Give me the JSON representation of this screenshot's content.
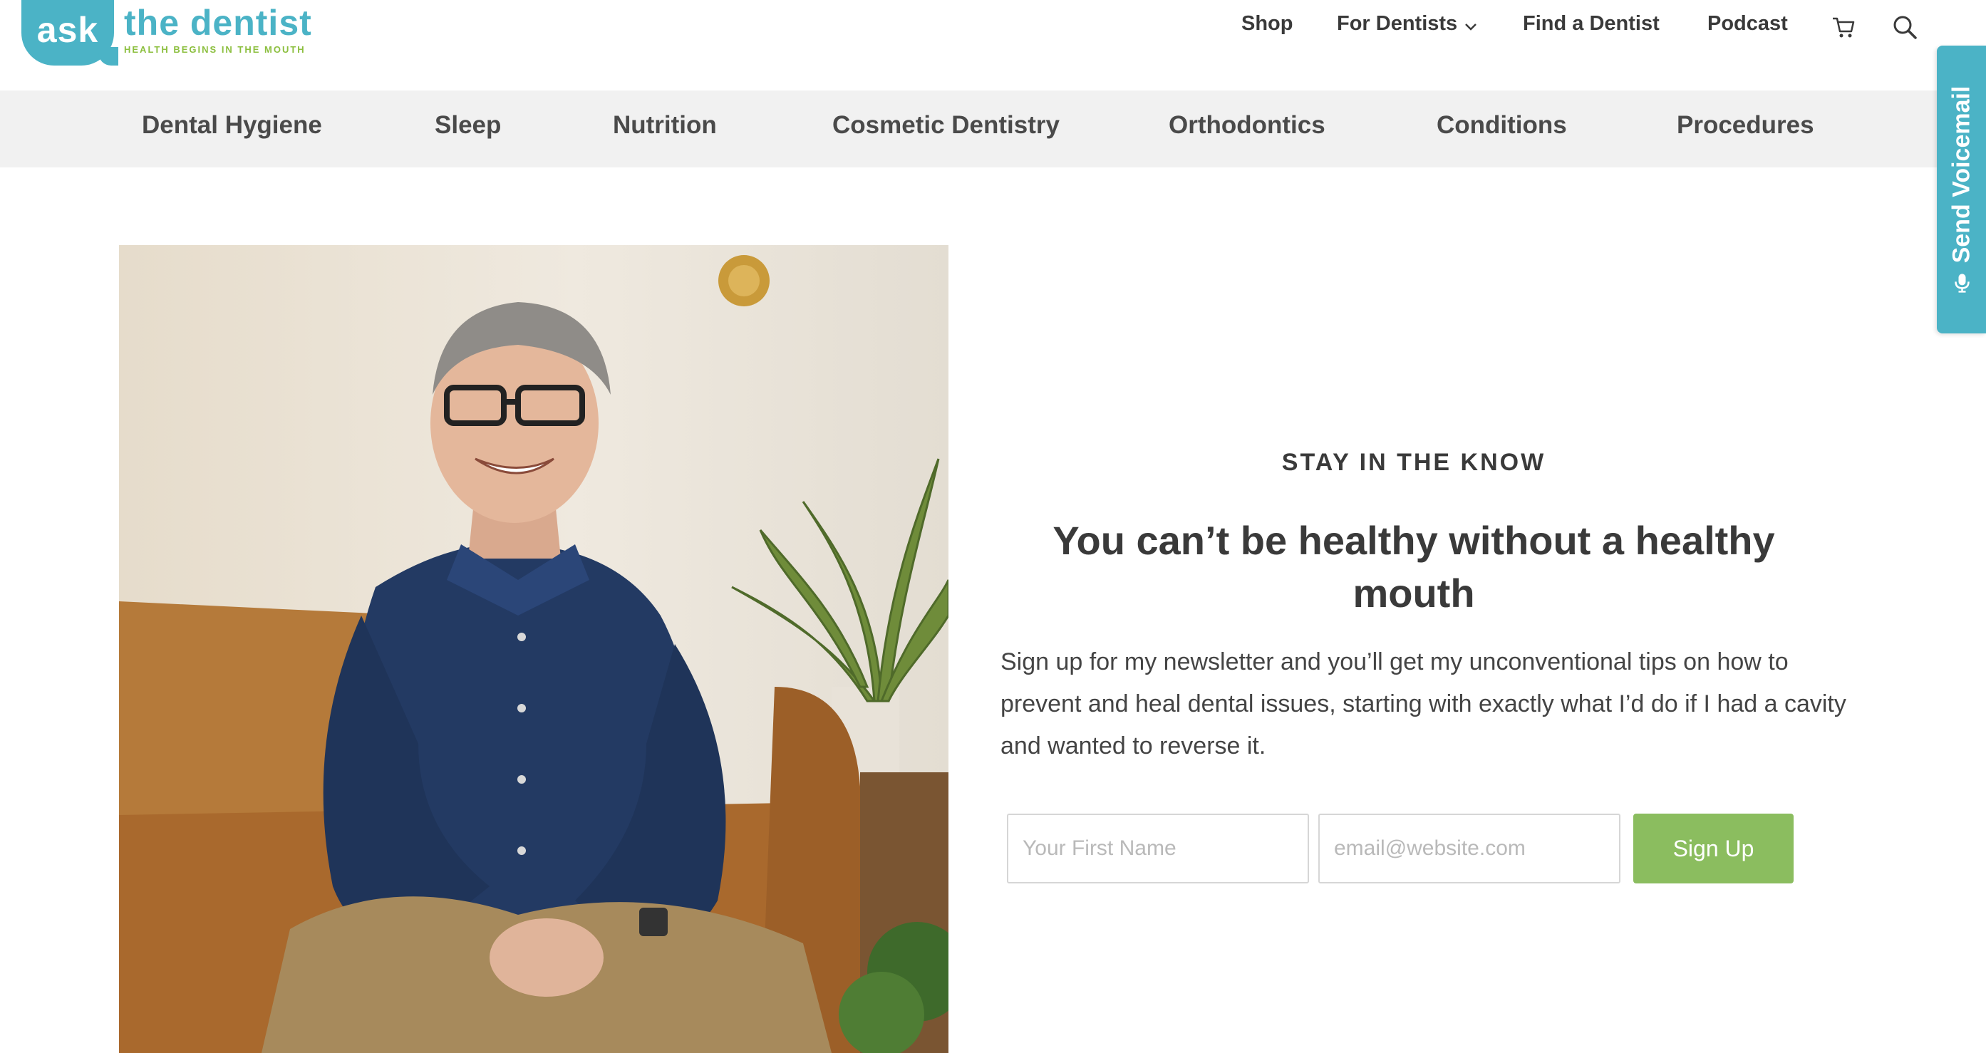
{
  "header": {
    "logo": {
      "ask": "ask",
      "name": "the dentist",
      "tagline": "HEALTH BEGINS IN THE MOUTH"
    },
    "nav": [
      {
        "label": "Shop"
      },
      {
        "label": "For Dentists",
        "icon": "chevron-down-icon"
      },
      {
        "label": "Find a Dentist"
      },
      {
        "label": "Podcast"
      }
    ],
    "icons": [
      "cart-icon",
      "search-icon"
    ]
  },
  "categories": [
    "Dental Hygiene",
    "Sleep",
    "Nutrition",
    "Cosmetic Dentistry",
    "Orthodontics",
    "Conditions",
    "Procedures"
  ],
  "voicemail": {
    "label": "Send Voicemail",
    "icon": "microphone-icon"
  },
  "newsletter": {
    "eyebrow": "STAY IN THE KNOW",
    "heading": "You can’t be healthy without a healthy mouth",
    "body": "Sign up for my newsletter and you’ll get my unconventional tips on how to prevent and heal dental issues, starting with exactly what I’d do if I had a cavity and wanted to reverse it.",
    "first_name_placeholder": "Your First Name",
    "email_placeholder": "email@website.com",
    "button_label": "Sign Up"
  },
  "colors": {
    "brand_teal": "#4bb3c6",
    "brand_green": "#8cbf3f",
    "button_green": "#8bbd5f",
    "category_bar": "#f1f1f1"
  }
}
